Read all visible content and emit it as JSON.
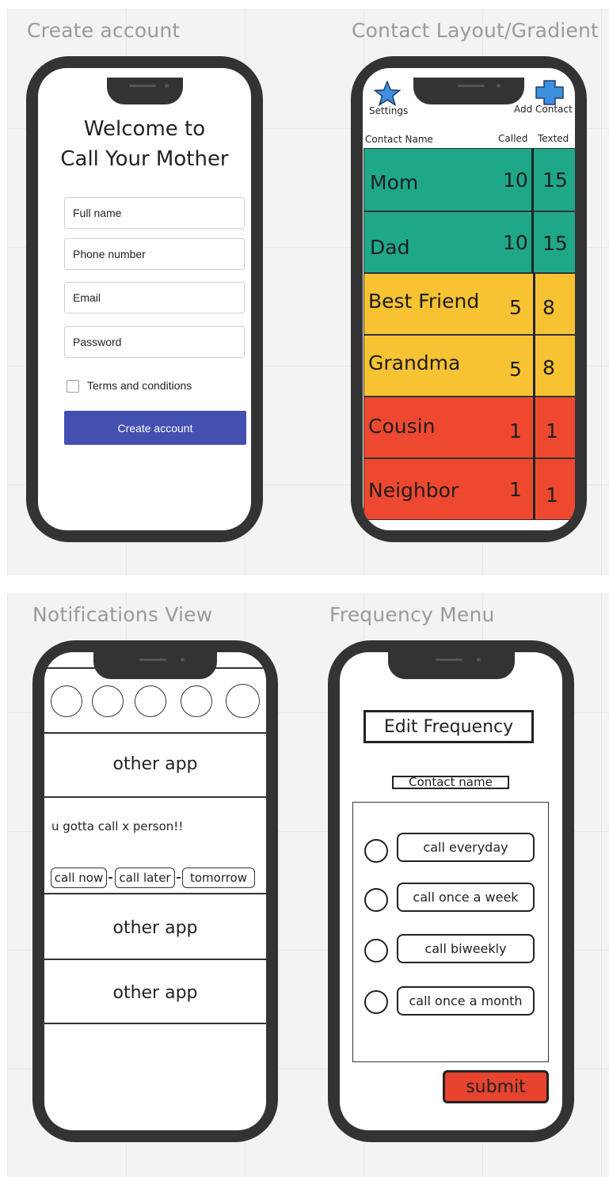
{
  "frames": {
    "create_account": "Create account",
    "contact_layout": "Contact Layout/Gradient",
    "notifications": "Notifications View",
    "frequency": "Frequency Menu"
  },
  "signup": {
    "welcome_line1": "Welcome to",
    "welcome_line2": "Call Your Mother",
    "full_name_placeholder": "Full name",
    "phone_placeholder": "Phone number",
    "email_placeholder": "Email",
    "password_placeholder": "Password",
    "terms_label": "Terms and conditions",
    "submit_label": "Create account",
    "button_color": "#4350b0"
  },
  "contacts": {
    "settings_label": "Settings",
    "add_contact_label": "Add Contact",
    "settings_icon": "star-icon",
    "add_icon": "plus-icon",
    "columns": [
      "Contact Name",
      "Called",
      "Texted"
    ],
    "rows": [
      {
        "name": "Mom",
        "called": "10",
        "texted": "15",
        "color": "#1fa888"
      },
      {
        "name": "Dad",
        "called": "10",
        "texted": "15",
        "color": "#1fa888"
      },
      {
        "name": "Best Friend",
        "called": "5",
        "texted": "8",
        "color": "#f7c332"
      },
      {
        "name": "Grandma",
        "called": "5",
        "texted": "8",
        "color": "#f7c332"
      },
      {
        "name": "Cousin",
        "called": "1",
        "texted": "1",
        "color": "#ee4930"
      },
      {
        "name": "Neighbor",
        "called": "1",
        "texted": "1",
        "color": "#ee4930"
      }
    ]
  },
  "notifications": {
    "other_app_1": "other app",
    "notification_text": "u gotta call x person!!",
    "call_now": "call now",
    "call_later": "call later",
    "tomorrow": "tomorrow",
    "other_app_2": "other app",
    "other_app_3": "other app"
  },
  "frequency": {
    "title": "Edit Frequency",
    "contact_name": "Contact name",
    "options": [
      "call everyday",
      "call once a week",
      "call biweekly",
      "call once a month"
    ],
    "submit_label": "submit",
    "submit_color": "#e8432e"
  }
}
